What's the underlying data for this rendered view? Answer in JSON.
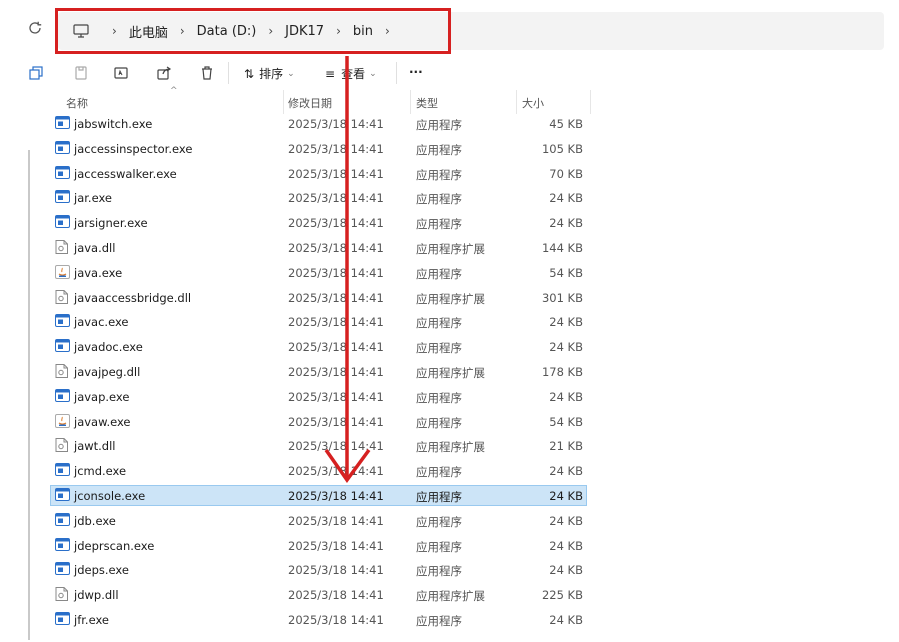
{
  "address": {
    "refresh_icon": "refresh-icon",
    "pc_icon": "computer-icon",
    "crumbs": [
      "此电脑",
      "Data (D:)",
      "JDK17",
      "bin"
    ]
  },
  "toolbar": {
    "sort_label": "排序",
    "view_label": "查看",
    "more_label": "···"
  },
  "columns": {
    "name": "名称",
    "date": "修改日期",
    "type": "类型",
    "size": "大小"
  },
  "colors": {
    "highlight": "#d62020",
    "selection_bg": "#cce4f7",
    "exe_icon": "#2a6fc9"
  },
  "files": [
    {
      "name": "jabswitch.exe",
      "date": "2025/3/18 14:41",
      "type": "应用程序",
      "size": "45 KB",
      "icon": "exe-icon"
    },
    {
      "name": "jaccessinspector.exe",
      "date": "2025/3/18 14:41",
      "type": "应用程序",
      "size": "105 KB",
      "icon": "exe-icon"
    },
    {
      "name": "jaccesswalker.exe",
      "date": "2025/3/18 14:41",
      "type": "应用程序",
      "size": "70 KB",
      "icon": "exe-icon"
    },
    {
      "name": "jar.exe",
      "date": "2025/3/18 14:41",
      "type": "应用程序",
      "size": "24 KB",
      "icon": "exe-icon"
    },
    {
      "name": "jarsigner.exe",
      "date": "2025/3/18 14:41",
      "type": "应用程序",
      "size": "24 KB",
      "icon": "exe-icon"
    },
    {
      "name": "java.dll",
      "date": "2025/3/18 14:41",
      "type": "应用程序扩展",
      "size": "144 KB",
      "icon": "dll-icon"
    },
    {
      "name": "java.exe",
      "date": "2025/3/18 14:41",
      "type": "应用程序",
      "size": "54 KB",
      "icon": "java-icon"
    },
    {
      "name": "javaaccessbridge.dll",
      "date": "2025/3/18 14:41",
      "type": "应用程序扩展",
      "size": "301 KB",
      "icon": "dll-icon"
    },
    {
      "name": "javac.exe",
      "date": "2025/3/18 14:41",
      "type": "应用程序",
      "size": "24 KB",
      "icon": "exe-icon"
    },
    {
      "name": "javadoc.exe",
      "date": "2025/3/18 14:41",
      "type": "应用程序",
      "size": "24 KB",
      "icon": "exe-icon"
    },
    {
      "name": "javajpeg.dll",
      "date": "2025/3/18 14:41",
      "type": "应用程序扩展",
      "size": "178 KB",
      "icon": "dll-icon"
    },
    {
      "name": "javap.exe",
      "date": "2025/3/18 14:41",
      "type": "应用程序",
      "size": "24 KB",
      "icon": "exe-icon"
    },
    {
      "name": "javaw.exe",
      "date": "2025/3/18 14:41",
      "type": "应用程序",
      "size": "54 KB",
      "icon": "java-icon"
    },
    {
      "name": "jawt.dll",
      "date": "2025/3/18 14:41",
      "type": "应用程序扩展",
      "size": "21 KB",
      "icon": "dll-icon"
    },
    {
      "name": "jcmd.exe",
      "date": "2025/3/18 14:41",
      "type": "应用程序",
      "size": "24 KB",
      "icon": "exe-icon"
    },
    {
      "name": "jconsole.exe",
      "date": "2025/3/18 14:41",
      "type": "应用程序",
      "size": "24 KB",
      "icon": "exe-icon",
      "selected": true
    },
    {
      "name": "jdb.exe",
      "date": "2025/3/18 14:41",
      "type": "应用程序",
      "size": "24 KB",
      "icon": "exe-icon"
    },
    {
      "name": "jdeprscan.exe",
      "date": "2025/3/18 14:41",
      "type": "应用程序",
      "size": "24 KB",
      "icon": "exe-icon"
    },
    {
      "name": "jdeps.exe",
      "date": "2025/3/18 14:41",
      "type": "应用程序",
      "size": "24 KB",
      "icon": "exe-icon"
    },
    {
      "name": "jdwp.dll",
      "date": "2025/3/18 14:41",
      "type": "应用程序扩展",
      "size": "225 KB",
      "icon": "dll-icon"
    },
    {
      "name": "jfr.exe",
      "date": "2025/3/18 14:41",
      "type": "应用程序",
      "size": "24 KB",
      "icon": "exe-icon"
    }
  ]
}
